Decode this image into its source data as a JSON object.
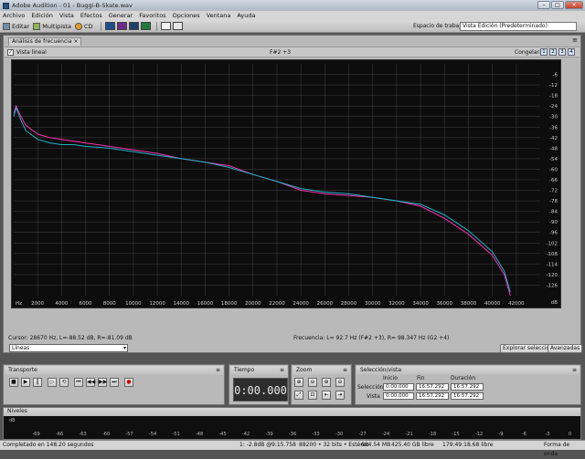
{
  "window": {
    "title": "Adobe Audition - 01 - Buggi-B-Skate.wav"
  },
  "menu": [
    "Archivo",
    "Edición",
    "Vista",
    "Efectos",
    "Generar",
    "Favoritos",
    "Opciones",
    "Ventana",
    "Ayuda"
  ],
  "toolbar": {
    "editar": "Editar",
    "multipista": "Multipista",
    "cd": "CD",
    "workspace_label": "Espacio de trabajo:",
    "workspace_value": "Vista Edición (Predeterminado)"
  },
  "panel": {
    "tab": "Análisis de frecuencia",
    "vista_lineal": "Vista lineal",
    "note": "F#2 +3",
    "congelar": "Congelar:",
    "freeze_buttons": [
      "1",
      "2",
      "3",
      "4"
    ],
    "cursor_label": "Cursor:",
    "cursor_value": "28670 Hz, L=-88.52 dB, R=-81.09 dB",
    "freq_label": "Frecuencia:",
    "freq_value": "L=  92.7 Hz (F#2 +3), R= 98.347 Hz (G2 +4)",
    "lines_option": "Líneas",
    "explore_button": "Explorar selección",
    "advanced_button": "Avanzadas"
  },
  "chart_data": {
    "type": "line",
    "xlabel": "Hz",
    "ylabel": "dB",
    "xlim": [
      0,
      44000
    ],
    "ylim": [
      -132,
      0
    ],
    "x_ticks": [
      2000,
      4000,
      6000,
      8000,
      10000,
      12000,
      14000,
      16000,
      18000,
      20000,
      22000,
      24000,
      26000,
      28000,
      30000,
      32000,
      34000,
      36000,
      38000,
      40000,
      42000
    ],
    "y_ticks": [
      -6,
      -12,
      -18,
      -24,
      -30,
      -36,
      -42,
      -48,
      -54,
      -60,
      -66,
      -72,
      -78,
      -84,
      -90,
      -96,
      -102,
      -108,
      -114,
      -120,
      -126
    ],
    "grid": true,
    "series": [
      {
        "color": "#ff2fb3",
        "x": [
          0,
          200,
          600,
          1000,
          2000,
          3000,
          4000,
          5000,
          6000,
          8000,
          10000,
          12000,
          14000,
          16000,
          18000,
          20000,
          22000,
          24000,
          26000,
          28000,
          30000,
          32000,
          34000,
          36000,
          38000,
          40000,
          41000,
          41500
        ],
        "y": [
          -28,
          -24,
          -30,
          -35,
          -40,
          -42,
          -43,
          -44,
          -45,
          -47,
          -49,
          -51,
          -54,
          -56,
          -58,
          -63,
          -67,
          -72,
          -74,
          -75,
          -76,
          -78,
          -81,
          -88,
          -97,
          -109,
          -120,
          -132
        ]
      },
      {
        "color": "#19b6c8",
        "x": [
          0,
          200,
          600,
          1000,
          2000,
          3000,
          4000,
          5000,
          6000,
          8000,
          10000,
          12000,
          14000,
          16000,
          18000,
          20000,
          22000,
          24000,
          26000,
          28000,
          30000,
          32000,
          34000,
          36000,
          38000,
          40000,
          41000,
          41500
        ],
        "y": [
          -30,
          -25,
          -32,
          -38,
          -43,
          -45,
          -46,
          -46,
          -47,
          -48,
          -50,
          -52,
          -54,
          -56,
          -59,
          -63,
          -67,
          -71,
          -73,
          -74,
          -76,
          -78,
          -80,
          -86,
          -95,
          -107,
          -118,
          -130
        ]
      }
    ]
  },
  "transport": {
    "title": "Transporte"
  },
  "tiempo": {
    "title": "Tiempo",
    "value": "0:00.000"
  },
  "zoom": {
    "title": "Zoom"
  },
  "selection": {
    "title": "Selección/vista",
    "col_inicio": "Inicio",
    "col_fin": "Fin",
    "col_duracion": "Duración",
    "row_seleccion": "Selección",
    "row_vista": "Vista",
    "sel_inicio": "0:00.000",
    "sel_fin": "16:57.292",
    "sel_dur": "16:57.292",
    "vis_inicio": "0:00.000",
    "vis_fin": "16:57.292",
    "vis_dur": "16:57.292"
  },
  "levels": {
    "title": "Niveles",
    "ticks": [
      "dB",
      "-69",
      "-66",
      "-63",
      "-60",
      "-57",
      "-54",
      "-51",
      "-48",
      "-45",
      "-42",
      "-39",
      "-36",
      "-33",
      "-30",
      "-27",
      "-24",
      "-21",
      "-18",
      "-15",
      "-12",
      "-9",
      "-6",
      "-3",
      "0"
    ]
  },
  "status": {
    "left": "Completado en 148.20 segundos",
    "db": "1: -2.8dB @",
    "time": "9:15.758",
    "format": "88200 • 32 bits • Estéreo",
    "size": "684.54 MB",
    "free": "425.40 GB libre",
    "time_free": "179:49:18.68 libre",
    "mode": "Forma de onda"
  }
}
